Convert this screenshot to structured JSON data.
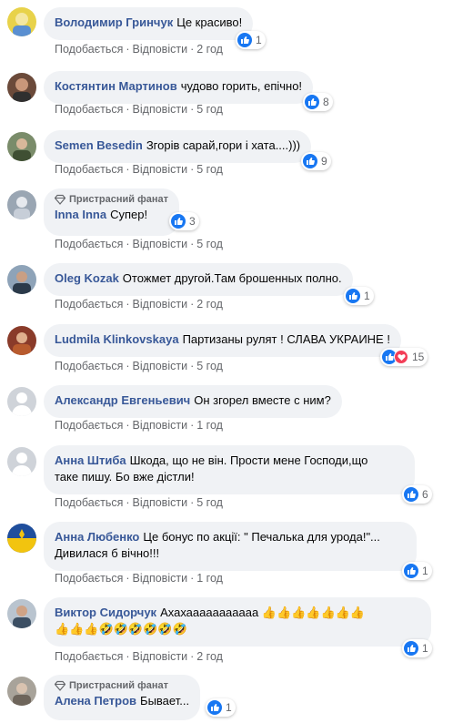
{
  "colors": {
    "author": "#385898",
    "bubble": "#f0f2f5",
    "meta": "#65676b",
    "like": "#1877f2",
    "love": "#f33e58"
  },
  "actions": {
    "like_label": "Подобається",
    "reply_label": "Відповісти",
    "separator": "·"
  },
  "comments": [
    {
      "author": "Володимир Гринчук",
      "text": "Це красиво!",
      "time": "2 год",
      "reactions": "1",
      "icons": [
        "like-icon"
      ]
    },
    {
      "author": "Костянтин Мартинов",
      "text": "чудово горить, епічно!",
      "time": "5 год",
      "reactions": "8",
      "icons": [
        "like-icon"
      ]
    },
    {
      "author": "Semen Besedin",
      "text": "Згорів сарай,гори і хата....)))",
      "time": "5 год",
      "reactions": "9",
      "icons": [
        "like-icon"
      ]
    },
    {
      "badge": "Пристрасний фанат",
      "author": "Inna Inna",
      "text": "Супер!",
      "time": "5 год",
      "reactions": "3",
      "icons": [
        "like-icon"
      ]
    },
    {
      "author": "Oleg Kozak",
      "text": "Отожмет другой.Там брошенных полно.",
      "time": "2 год",
      "reactions": "1",
      "icons": [
        "like-icon"
      ]
    },
    {
      "author": "Ludmila Klinkovskaya",
      "text": "Партизаны рулят ! СЛАВА УКРАИНЕ !",
      "time": "5 год",
      "reactions": "15",
      "icons": [
        "like-icon",
        "love-icon"
      ]
    },
    {
      "author": "Александр Евгеньевич",
      "text": "Он згорел вместе с ним?",
      "time": "1 год",
      "reactions": null,
      "icons": []
    },
    {
      "author": "Анна Штиба",
      "text": "Шкода, що не він. Прости мене Господи,що",
      "text2": "таке пишу. Бо вже дістли!",
      "time": "5 год",
      "reactions": "6",
      "icons": [
        "like-icon"
      ]
    },
    {
      "author": "Анна Любенко",
      "text": "Це бонус по акції: \" Печалька для урода!\"...",
      "text2": "Дивилася б вічно!!!",
      "time": "1 год",
      "reactions": "1",
      "icons": [
        "like-icon"
      ]
    },
    {
      "author": "Виктор Сидорчук",
      "text": "Ахахааааааааааа 👍👍👍👍👍👍👍",
      "text2": "👍👍👍🤣🤣🤣🤣🤣🤣",
      "time": "2 год",
      "reactions": "1",
      "icons": [
        "like-icon"
      ]
    },
    {
      "badge": "Пристрасний фанат",
      "author": "Алена Петров",
      "text": "Бывает...",
      "time": null,
      "reactions": "1",
      "icons": [
        "like-icon"
      ]
    }
  ]
}
